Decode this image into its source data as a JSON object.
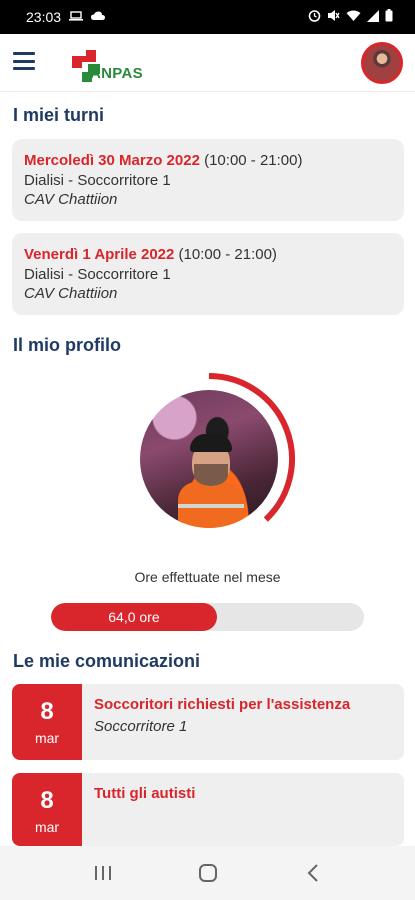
{
  "status_bar": {
    "time": "23:03",
    "left_icons": [
      "laptop-icon",
      "cloud-icon"
    ],
    "right_icons": [
      "alarm-icon",
      "mute-icon",
      "wifi-icon",
      "signal-icon",
      "battery-icon"
    ]
  },
  "app_bar": {
    "logo_text": "ANPAS"
  },
  "shifts": {
    "title": "I miei turni",
    "items": [
      {
        "date": "Mercoledì 30 Marzo 2022",
        "time": "(10:00 - 21:00)",
        "role": "Dialisi - Soccorritore 1",
        "place": "CAV Chattiion"
      },
      {
        "date": "Venerdì 1 Aprile 2022",
        "time": "(10:00 - 21:00)",
        "role": "Dialisi - Soccorritore 1",
        "place": "CAV Chattiion"
      }
    ]
  },
  "profile": {
    "title": "Il mio profilo",
    "hours_label": "Ore effettuate nel mese",
    "hours_value": "64,0 ore",
    "hours_fraction": 0.53,
    "ring_fraction": 0.38
  },
  "communications": {
    "title": "Le mie comunicazioni",
    "items": [
      {
        "day": "8",
        "month": "mar",
        "title": "Soccoritori richiesti per l'assistenza",
        "subtitle": "Soccorritore 1"
      },
      {
        "day": "8",
        "month": "mar",
        "title": "Tutti gli autisti",
        "subtitle": ""
      }
    ]
  },
  "colors": {
    "accent": "#d8262c",
    "heading": "#1f3a63",
    "card": "#efefef",
    "logo_green": "#2a8a3c"
  }
}
